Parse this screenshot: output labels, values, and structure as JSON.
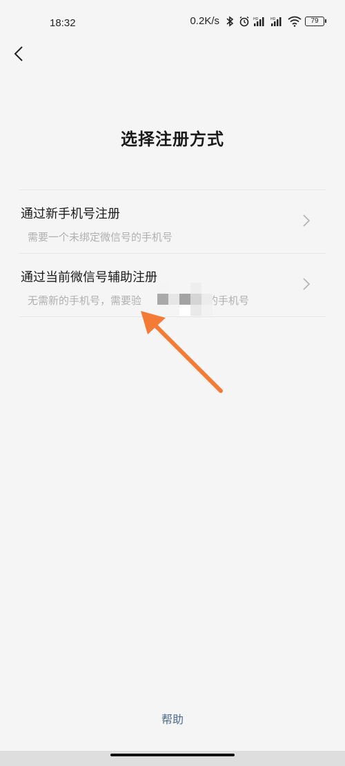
{
  "status_bar": {
    "time": "18:32",
    "network_speed": "0.2K/s",
    "battery": "79",
    "icons": [
      "bluetooth-icon",
      "alarm-icon",
      "signal-hd-icon",
      "signal-hd-icon",
      "wifi-icon",
      "battery-icon"
    ]
  },
  "header": {
    "back_icon": "chevron-left-icon",
    "title": "选择注册方式"
  },
  "options": [
    {
      "title": "通过新手机号注册",
      "description": "需要一个未绑定微信号的手机号",
      "icon": "chevron-right-icon"
    },
    {
      "title": "通过当前微信号辅助注册",
      "description": "无需新的手机号，需要验",
      "description_tail": "的手机号",
      "icon": "chevron-right-icon"
    }
  ],
  "footer": {
    "help_label": "帮助"
  },
  "annotation": {
    "arrow_color": "#f47b36"
  },
  "colors": {
    "background": "#f5f5f5",
    "link": "#4a6a93",
    "muted": "#b0b0b0"
  }
}
